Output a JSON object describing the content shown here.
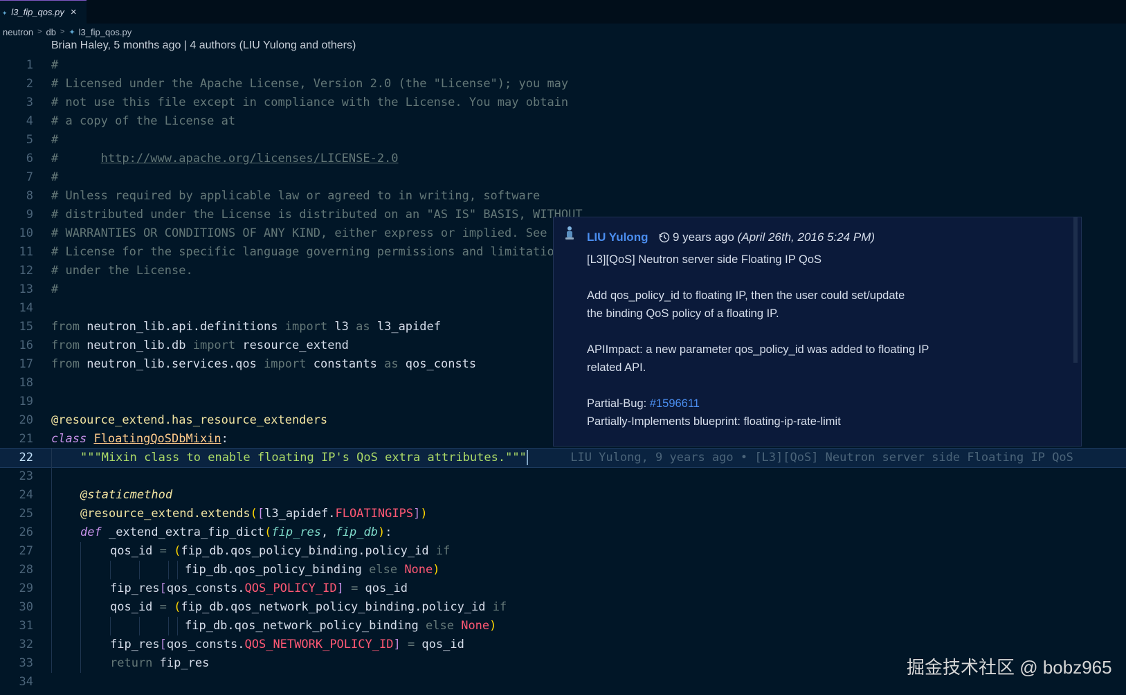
{
  "tab": {
    "label": "l3_fip_qos.py",
    "icon": "python-file-icon",
    "close": "×"
  },
  "breadcrumb": {
    "items": [
      "neutron",
      "db",
      "l3_fip_qos.py"
    ]
  },
  "blame_header": "Brian Haley, 5 months ago | 4 authors (LIU Yulong and others)",
  "lines": {
    "n1": "1",
    "n2": "2",
    "n3": "3",
    "n4": "4",
    "n5": "5",
    "n6": "6",
    "n7": "7",
    "n8": "8",
    "n9": "9",
    "n10": "10",
    "n11": "11",
    "n12": "12",
    "n13": "13",
    "n14": "14",
    "n15": "15",
    "n16": "16",
    "n17": "17",
    "n18": "18",
    "n19": "19",
    "n20": "20",
    "n21": "21",
    "n22": "22",
    "n23": "23",
    "n24": "24",
    "n25": "25",
    "n26": "26",
    "n27": "27",
    "n28": "28",
    "n29": "29",
    "n30": "30",
    "n31": "31",
    "n32": "32",
    "n33": "33",
    "n34": "34"
  },
  "code": {
    "l1": "#",
    "l2": "# Licensed under the Apache License, Version 2.0 (the \"License\"); you may",
    "l3": "# not use this file except in compliance with the License. You may obtain",
    "l4": "# a copy of the License at",
    "l5": "#",
    "l6a": "#      ",
    "l6b": "http://www.apache.org/licenses/LICENSE-2.0",
    "l7": "#",
    "l8": "# Unless required by applicable law or agreed to in writing, software",
    "l9": "# distributed under the License is distributed on an \"AS IS\" BASIS, WITHOUT",
    "l10": "# WARRANTIES OR CONDITIONS OF ANY KIND, either express or implied. See the",
    "l11": "# License for the specific language governing permissions and limitations",
    "l12": "# under the License.",
    "l13": "#",
    "l15": [
      "from",
      " neutron_lib.api.definitions ",
      "import",
      " l3 ",
      "as",
      " l3_apidef"
    ],
    "l16": [
      "from",
      " neutron_lib.db ",
      "import",
      " resource_extend"
    ],
    "l17": [
      "from",
      " neutron_lib.services.qos ",
      "import",
      " constants ",
      "as",
      " qos_consts"
    ],
    "l20": "@resource_extend.has_resource_extenders",
    "l21": [
      "class",
      " ",
      "FloatingQoSDbMixin",
      ":"
    ],
    "l22": "\"\"\"Mixin class to enable floating IP's QoS extra attributes.\"\"\"",
    "l22_blame": "LIU Yulong, 9 years ago • [L3][QoS] Neutron server side Floating IP QoS",
    "l24": "@staticmethod",
    "l25": [
      "@resource_extend.extends",
      "(",
      "[",
      "l3_apidef.",
      "FLOATINGIPS",
      "]",
      ")"
    ],
    "l26": [
      "def",
      " _extend_extra_fip_dict",
      "(",
      "fip_res",
      ", ",
      "fip_db",
      ")",
      ":"
    ],
    "l27": [
      "qos_id ",
      "=",
      " ",
      "(",
      "fip_db.qos_policy_binding.policy_id ",
      "if"
    ],
    "l28": [
      "fip_db.qos_policy_binding ",
      "else",
      " ",
      "None",
      ")"
    ],
    "l29": [
      "fip_res",
      "[",
      "qos_consts.",
      "QOS_POLICY_ID",
      "]",
      " ",
      "=",
      " qos_id"
    ],
    "l30": [
      "qos_id ",
      "=",
      " ",
      "(",
      "fip_db.qos_network_policy_binding.policy_id ",
      "if"
    ],
    "l31": [
      "fip_db.qos_network_policy_binding ",
      "else",
      " ",
      "None",
      ")"
    ],
    "l32": [
      "fip_res",
      "[",
      "qos_consts.",
      "QOS_NETWORK_POLICY_ID",
      "]",
      " ",
      "=",
      " qos_id"
    ],
    "l33": [
      "return",
      " fip_res"
    ]
  },
  "hover": {
    "avatar": "avatar-icon",
    "author": "LIU Yulong",
    "time": "9 years ago",
    "date": "(April 26th, 2016 5:24 PM)",
    "subject": "[L3][QoS] Neutron server side Floating IP QoS",
    "body1": "Add qos_policy_id to floating IP, then the user could set/update",
    "body2": "the binding QoS policy of a floating IP.",
    "body3": "APIImpact: a new parameter qos_policy_id was added to floating IP",
    "body4": "related API.",
    "bug_label": "Partial-Bug: ",
    "bug_link": "#1596611",
    "blueprint": "Partially-Implements blueprint: floating-ip-rate-limit"
  },
  "watermark": "掘金技术社区 @ bobz965",
  "colors": {
    "background": "#011627",
    "comment": "#637777",
    "keyword": "#c792ea",
    "string": "#addb67",
    "link": "#4b8ef0"
  }
}
